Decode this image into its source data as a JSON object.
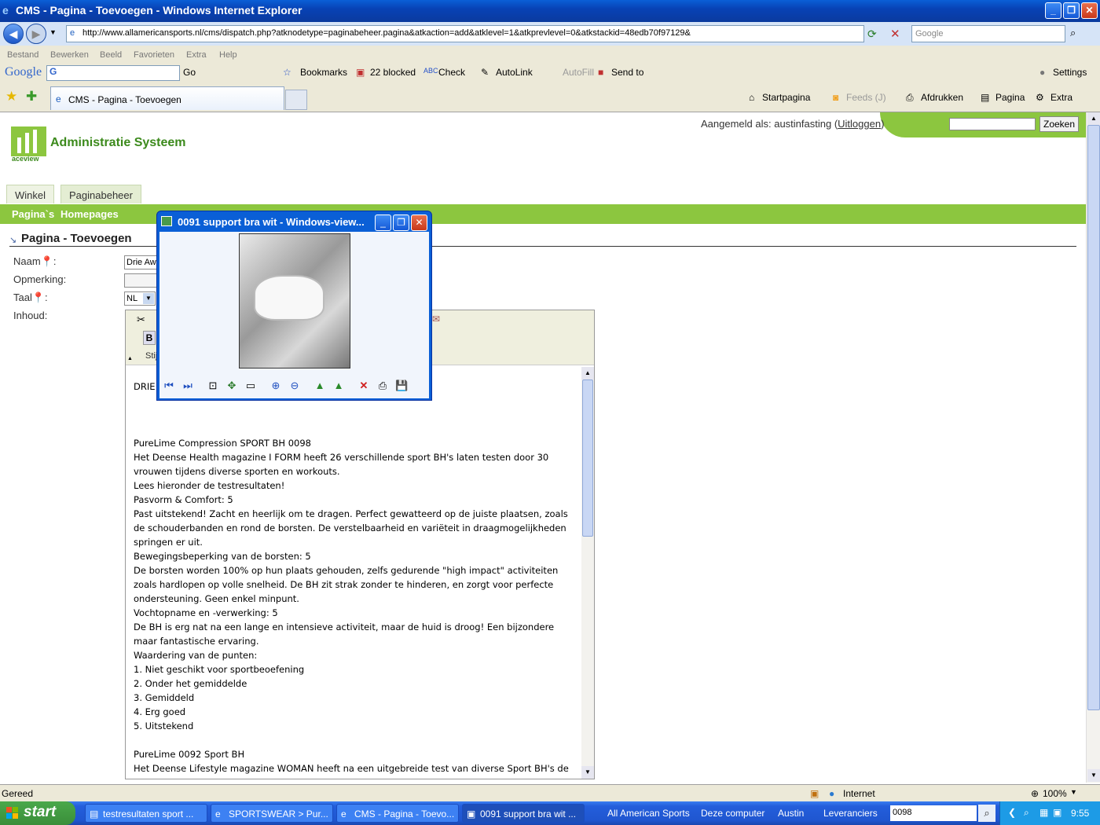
{
  "window": {
    "title": "CMS - Pagina - Toevoegen - Windows Internet Explorer",
    "minimize": "‗",
    "maximize": "❐",
    "close": "✕"
  },
  "address": {
    "url": "http://www.allamericansports.nl/cms/dispatch.php?atknodetype=paginabeheer.pagina&atkaction=add&atklevel=1&atkprevlevel=0&atkstackid=48edb70f97129&",
    "search_placeholder": "Google"
  },
  "menu": [
    "Bestand",
    "Bewerken",
    "Beeld",
    "Favorieten",
    "Extra",
    "Help"
  ],
  "gtoolbar": {
    "google": "Google",
    "go": "Go",
    "bookmarks": "Bookmarks",
    "blocked": "22 blocked",
    "check": "Check",
    "autolink": "AutoLink",
    "autofill": "AutoFill",
    "sendto": "Send to",
    "settings": "Settings"
  },
  "tabs": {
    "active": "CMS - Pagina - Toevoegen",
    "startpagina": "Startpagina",
    "feeds": "Feeds (J)",
    "afdrukken": "Afdrukken",
    "pagina": "Pagina",
    "extra": "Extra"
  },
  "cms": {
    "logged_in_prefix": "Aangemeld als: austinfasting (",
    "logout": "Uitloggen",
    "logged_in_suffix": ")",
    "search_button": "Zoeken",
    "brand": "Administratie Systeem",
    "brand_sub": "aceview",
    "main_tabs": [
      "Winkel",
      "Paginabeheer"
    ],
    "sub_nav": [
      "Pagina`s",
      "Homepages"
    ],
    "page_title": "Pagina - Toevoegen",
    "labels": {
      "naam": "Naam",
      "opmerking": "Opmerking:",
      "taal": "Taal",
      "inhoud": "Inhoud:"
    },
    "naam_value": "Drie Awa",
    "taal_value": "NL",
    "editor_style_label": "Stij",
    "editor_text": "DRIE\n\n\n\nPureLime Compression SPORT BH 0098\nHet Deense Health magazine I FORM heeft 26 verschillende sport BH's laten testen door 30\nvrouwen tijdens diverse sporten en workouts.\nLees hieronder de testresultaten!\nPasvorm & Comfort: 5\nPast uitstekend! Zacht en heerlijk om te dragen. Perfect gewatteerd op de juiste plaatsen, zoals\nde schouderbanden en rond de borsten. De verstelbaarheid en variëteit in draagmogelijkheden\nspringen er uit.\nBewegingsbeperking van de borsten: 5\nDe borsten worden 100% op hun plaats gehouden, zelfs gedurende \"high impact\" activiteiten\nzoals hardlopen op volle snelheid. De BH zit strak zonder te hinderen, en zorgt voor perfecte\nondersteuning. Geen enkel minpunt.\nVochtopname en -verwerking: 5\nDe BH is erg nat na een lange en intensieve activiteit, maar de huid is droog! Een bijzondere\nmaar fantastische ervaring.\nWaardering van de punten:\n1. Niet geschikt voor sportbeoefening\n2. Onder het gemiddelde\n3. Gemiddeld\n4. Erg goed\n5. Uitstekend\n\nPureLime 0092 Sport BH\nHet Deense Lifestyle magazine WOMAN heeft na een uitgebreide test van diverse Sport BH's de"
  },
  "popup": {
    "title": "0091 support bra wit - Windows-view..."
  },
  "status": {
    "text": "Gereed",
    "zone": "Internet",
    "zoom": "100%"
  },
  "taskbar": {
    "start": "start",
    "tasks": [
      "testresultaten sport ...",
      "SPORTSWEAR > Pur...",
      "CMS - Pagina - Toevo...",
      "0091 support bra wit ..."
    ],
    "links": [
      "All American Sports",
      "Deze computer",
      "Austin",
      "Leveranciers"
    ],
    "search_value": "0098",
    "clock": "9:55"
  },
  "colors": {
    "cms_green": "#8cc63f",
    "xp_blue": "#0a5fd6"
  }
}
